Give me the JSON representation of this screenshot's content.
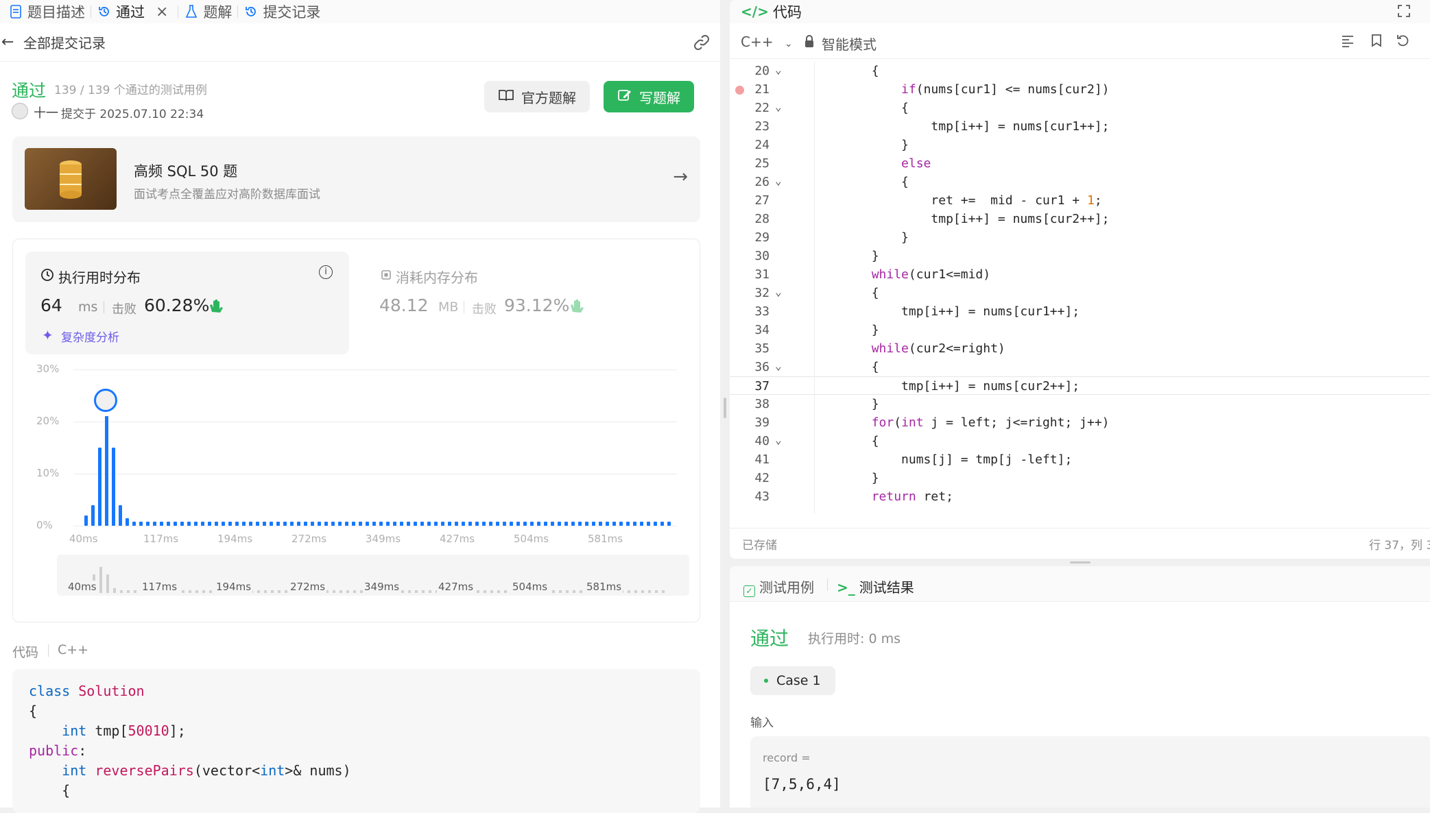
{
  "tabs": [
    {
      "label": "题目描述",
      "icon": "document-icon"
    },
    {
      "label": "通过",
      "icon": "history-icon"
    },
    {
      "label": "题解",
      "icon": "flask-icon"
    },
    {
      "label": "提交记录",
      "icon": "history-icon"
    }
  ],
  "subheader": {
    "back_label": "全部提交记录"
  },
  "submission": {
    "status": "通过",
    "testcases": "139 / 139 个通过的测试用例",
    "user": "十一",
    "submitted_at": "提交于 2025.07.10 22:34",
    "official_solution_label": "官方题解",
    "write_solution_label": "写题解"
  },
  "promo": {
    "title": "高频 SQL 50 题",
    "subtitle": "面试考点全覆盖应对高阶数据库面试"
  },
  "runtime": {
    "title": "执行用时分布",
    "value": "64",
    "unit": "ms",
    "beats_label": "击败",
    "beats": "60.28%",
    "complexity_label": "复杂度分析"
  },
  "memory": {
    "title": "消耗内存分布",
    "value": "48.12",
    "unit": "MB",
    "beats_label": "击败",
    "beats": "93.12%"
  },
  "chart_data": {
    "type": "bar",
    "yticks": [
      "30%",
      "20%",
      "10%",
      "0%"
    ],
    "ylim": [
      0,
      30
    ],
    "xticks": [
      "40ms",
      "117ms",
      "194ms",
      "272ms",
      "349ms",
      "427ms",
      "504ms",
      "581ms"
    ],
    "series": [
      {
        "values": [
          2,
          4,
          15,
          21,
          15,
          4,
          1.5,
          0.4,
          0.3,
          0.3,
          0.3,
          0.3,
          0.3,
          0.3,
          0.3,
          0.3,
          0.3,
          0.3,
          0.3,
          0.3,
          0.3,
          0.3,
          0.3,
          0.3,
          0.3,
          0.3,
          0.4,
          0.4,
          0.6,
          0.5,
          0.4,
          0.3,
          0.3,
          0.3,
          0.3,
          0.3,
          0.3,
          0.3,
          0.3,
          0.3,
          0.3,
          0.3,
          0.3,
          0.3,
          0.3,
          0.3,
          0.3,
          0.3,
          0.3,
          0.3,
          0.3,
          0.3,
          0.3,
          0.3,
          0.3,
          0.3,
          0.3,
          0.3,
          0.3,
          0.3,
          0.3,
          0.3,
          0.3,
          0.3,
          0.3,
          0.3,
          0.3,
          0.3,
          0.3,
          0.3,
          0.3,
          0.3,
          0.3,
          0.3,
          0.3,
          0.3,
          0.3,
          0.3,
          0.3,
          0.3,
          0.3,
          0.3,
          0.3,
          0.3,
          0.3,
          0.3
        ]
      }
    ],
    "marker_index": 3,
    "grid": true
  },
  "code_section": {
    "label": "代码",
    "lang": "C++"
  },
  "left_code": [
    [
      {
        "t": "class ",
        "c": "type"
      },
      {
        "t": "Solution",
        "c": "fn"
      }
    ],
    [
      {
        "t": "{",
        "c": ""
      }
    ],
    [
      {
        "t": "    ",
        "c": ""
      },
      {
        "t": "int",
        "c": "type"
      },
      {
        "t": " tmp[",
        "c": ""
      },
      {
        "t": "50010",
        "c": "fn"
      },
      {
        "t": "];",
        "c": ""
      }
    ],
    [
      {
        "t": "public",
        "c": "kw"
      },
      {
        "t": ":",
        "c": ""
      }
    ],
    [
      {
        "t": "    ",
        "c": ""
      },
      {
        "t": "int",
        "c": "type"
      },
      {
        "t": " ",
        "c": ""
      },
      {
        "t": "reversePairs",
        "c": "fn"
      },
      {
        "t": "(vector<",
        "c": ""
      },
      {
        "t": "int",
        "c": "type"
      },
      {
        "t": ">& nums)",
        "c": ""
      }
    ],
    [
      {
        "t": "    {",
        "c": ""
      }
    ]
  ],
  "editor": {
    "title": "代码",
    "lang": "C++",
    "mode": "智能模式",
    "saved": "已存储",
    "cursor": "行 37，列 3",
    "start_line": 20,
    "lines": [
      "        {",
      "            if(nums[cur1] <= nums[cur2])",
      "            {",
      "                tmp[i++] = nums[cur1++];",
      "            }",
      "            else",
      "            {",
      "                ret +=  mid - cur1 + 1;",
      "                tmp[i++] = nums[cur2++];",
      "            }",
      "        }",
      "        while(cur1<=mid)",
      "        {",
      "            tmp[i++] = nums[cur1++];",
      "        }",
      "        while(cur2<=right)",
      "        {",
      "            tmp[i++] = nums[cur2++];",
      "        }",
      "        for(int j = left; j<=right; j++)",
      "        {",
      "            nums[j] = tmp[j -left];",
      "        }",
      "        return ret;"
    ],
    "fold_lines": [
      20,
      22,
      26,
      32,
      36,
      40
    ],
    "breakpoint_line": 21,
    "active_line": 37
  },
  "result_panel": {
    "tab_testcase": "测试用例",
    "tab_result": "测试结果",
    "status": "通过",
    "runtime": "执行用时: 0 ms",
    "case_label": "Case 1",
    "input_label": "输入",
    "var_name": "record =",
    "var_value": "[7,5,6,4]"
  },
  "colors": {
    "accent_green": "#2db55d",
    "accent_blue": "#1677ff",
    "muted": "#8c8c8c"
  }
}
